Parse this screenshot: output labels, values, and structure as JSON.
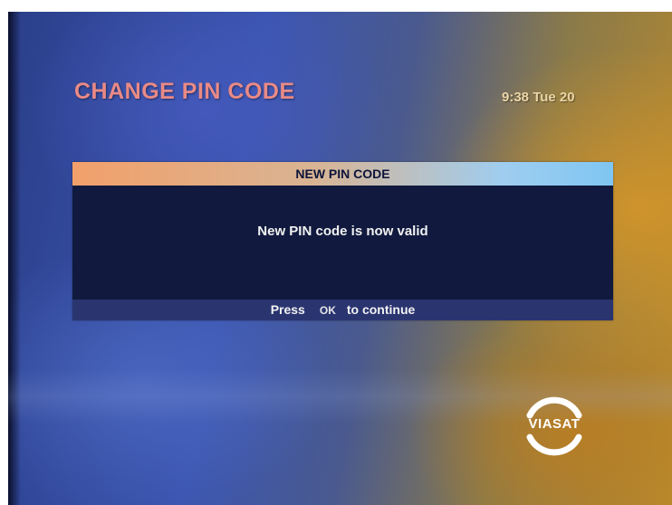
{
  "header": {
    "title": "CHANGE PIN CODE",
    "clock": "9:38 Tue 20"
  },
  "dialog": {
    "title": "NEW PIN CODE",
    "message": "New PIN code is now valid",
    "footer": {
      "press": "Press",
      "key": "OK",
      "continue": "to continue"
    }
  },
  "brand": {
    "name": "VIASAT",
    "logo_icon": "viasat-arc-logo-icon"
  },
  "colors": {
    "title": "#e98a86",
    "clock": "#ead5a6",
    "dialog_bg": "#111a3e",
    "footer_bg": "#2a3570"
  }
}
